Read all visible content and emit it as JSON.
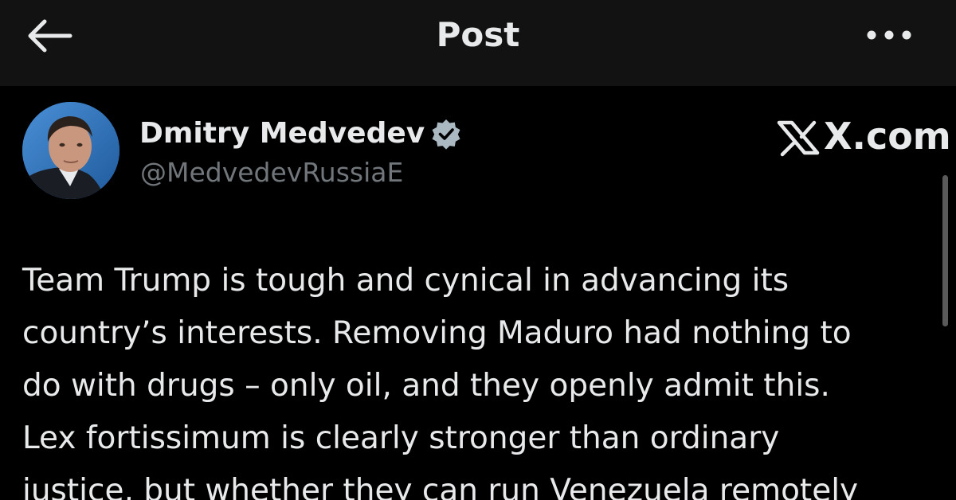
{
  "header": {
    "title": "Post",
    "back_icon": "arrow-left-icon",
    "more_icon": "more-horizontal-icon"
  },
  "post": {
    "author": {
      "name": "Dmitry Medvedev",
      "handle": "@MedvedevRussiaE",
      "verified_icon": "verified-badge-icon",
      "verified_color": "#aab8c2"
    },
    "watermark": "X.com",
    "text_lines": [
      "Team Trump is tough and cynical in advancing its",
      "country’s interests. Removing Maduro had nothing to",
      "do with drugs – only oil, and they openly admit this.",
      "Lex fortissimum is clearly stronger than ordinary",
      "justice, but whether they can run Venezuela remotely"
    ]
  },
  "colors": {
    "background": "#000000",
    "header_background": "#121212",
    "primary_text": "#e7e9ea",
    "secondary_text": "#71767b"
  }
}
